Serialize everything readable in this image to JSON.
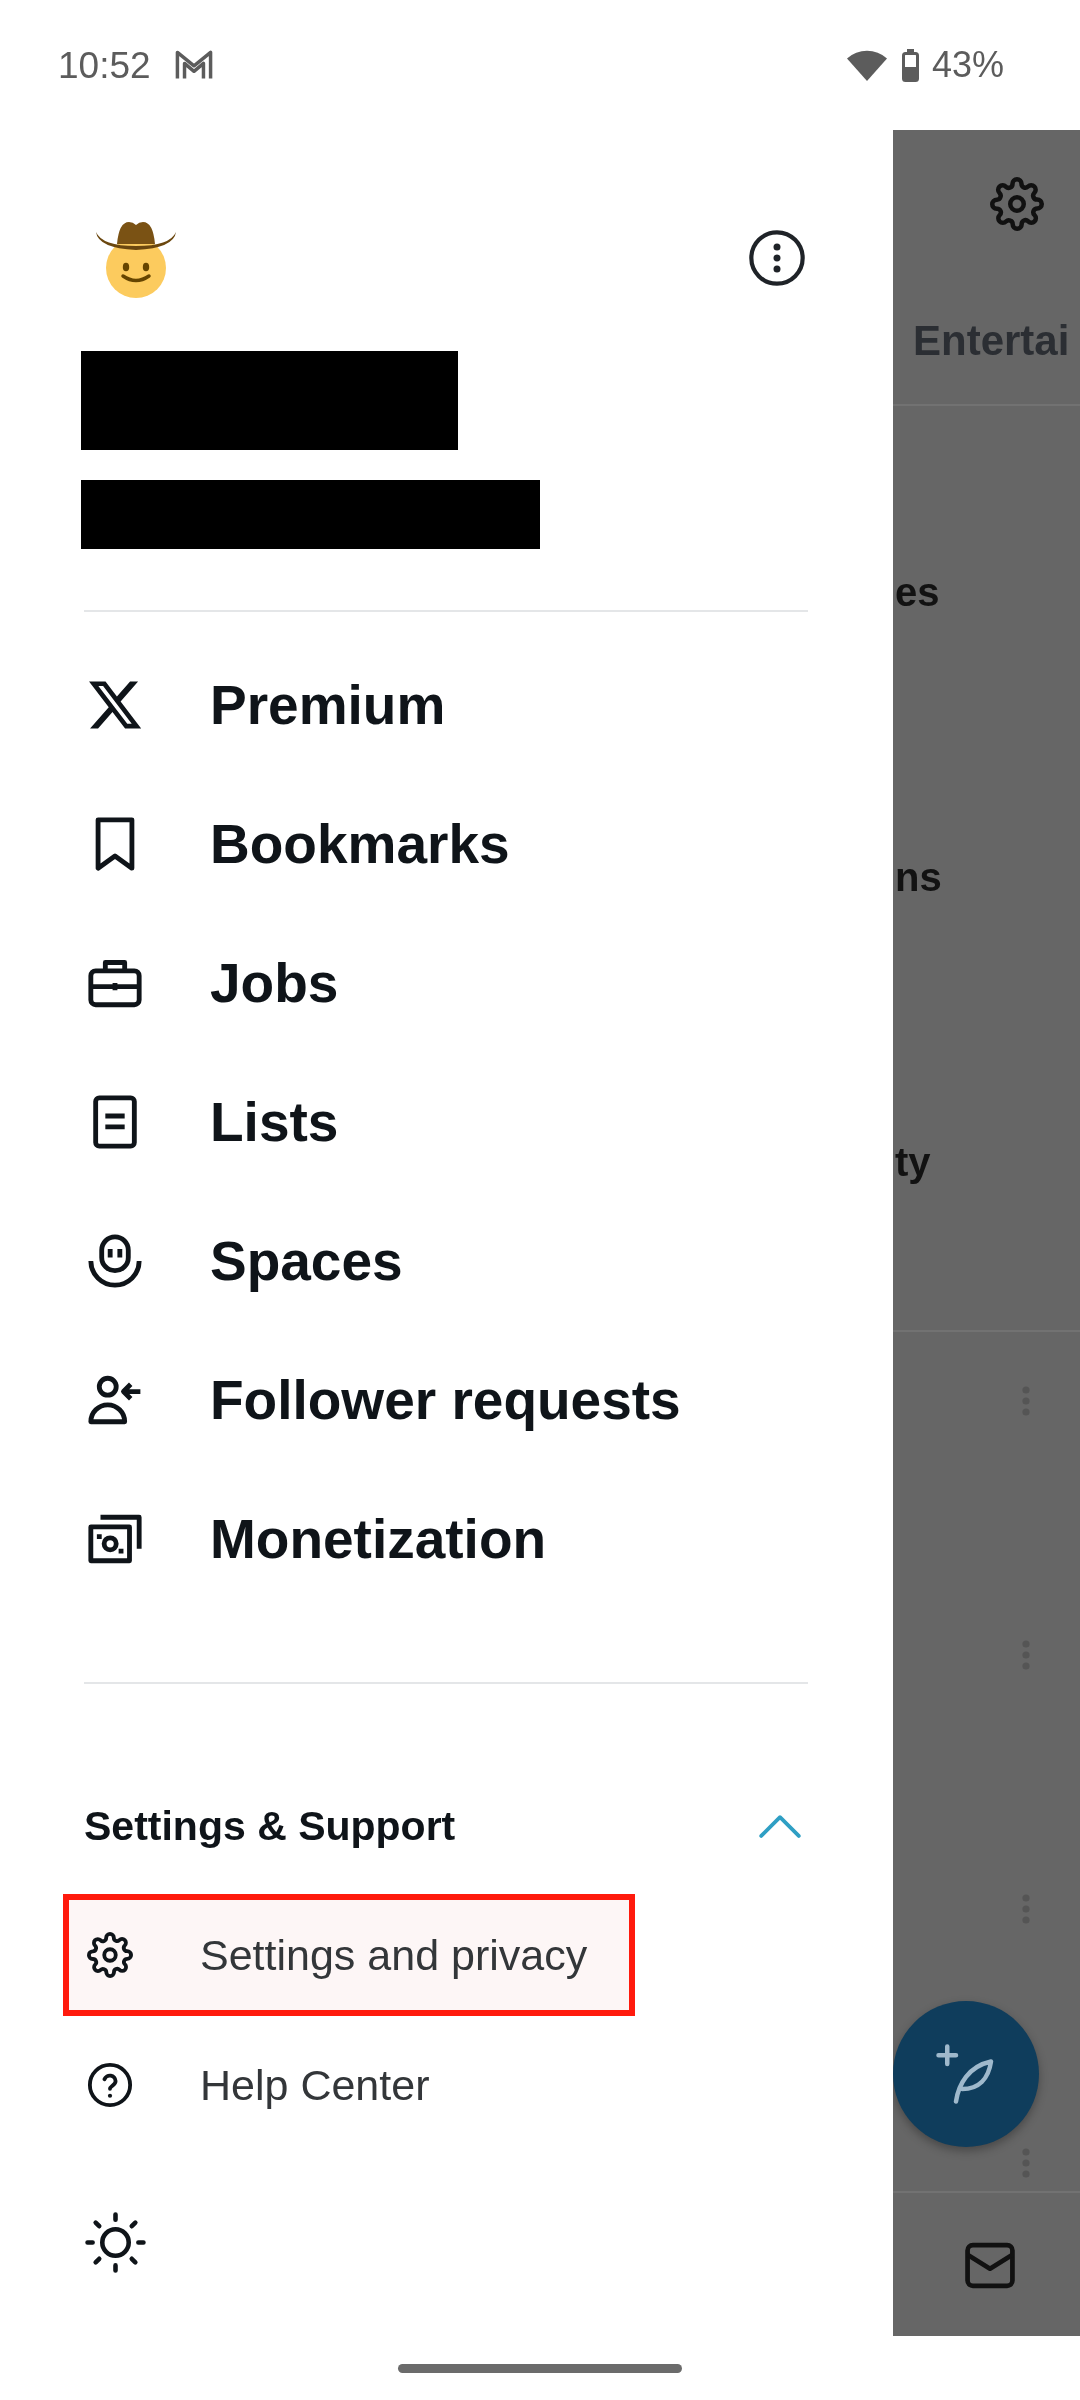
{
  "status_bar": {
    "time": "10:52",
    "battery": "43%"
  },
  "drawer": {
    "menu": [
      "Premium",
      "Bookmarks",
      "Jobs",
      "Lists",
      "Spaces",
      "Follower requests",
      "Monetization"
    ],
    "settings_support": {
      "title": "Settings & Support",
      "expanded": true,
      "items": [
        {
          "label": "Settings and privacy",
          "highlighted": true
        },
        {
          "label": "Help Center",
          "highlighted": false
        }
      ]
    }
  },
  "background": {
    "tab": "Entertai",
    "rows": [
      "es",
      "ns",
      "ty"
    ]
  }
}
